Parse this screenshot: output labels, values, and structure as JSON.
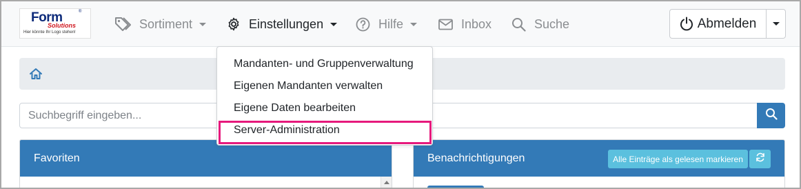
{
  "brand": {
    "logo_word": "Form",
    "logo_registered": "®",
    "logo_sub": "Solutions",
    "logo_tagline": "Hier könnte Ihr Logo stehen!"
  },
  "nav": {
    "sortiment": "Sortiment",
    "einstellungen": "Einstellungen",
    "hilfe": "Hilfe",
    "inbox": "Inbox",
    "suche": "Suche",
    "logout": "Abmelden"
  },
  "dropdown": {
    "items": [
      "Mandanten- und Gruppenverwaltung",
      "Eigenen Mandanten verwalten",
      "Eigene Daten bearbeiten",
      "Server-Administration"
    ],
    "highlighted_index": 3
  },
  "search": {
    "placeholder": "Suchbegriff eingeben..."
  },
  "panels": {
    "favorites_title": "Favoriten",
    "notifications_title": "Benachrichtigungen",
    "mark_all_read": "Alle Einträge als gelesen markieren"
  },
  "colors": {
    "primary": "#337ab7",
    "info": "#5bc0de",
    "highlight": "#e6197c"
  }
}
